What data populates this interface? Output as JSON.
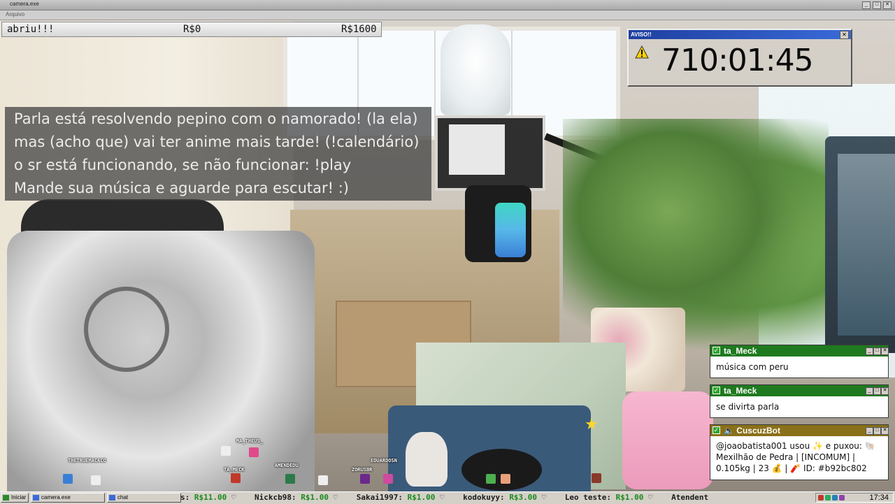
{
  "window": {
    "title": "camera.exe",
    "menu": "Arquivo"
  },
  "money_bar": {
    "label": "abriu!!!",
    "current": "R$0",
    "goal": "R$1600"
  },
  "aviso": {
    "title": "AVISO!!",
    "timer": "710:01:45",
    "close": "✕"
  },
  "notice": {
    "lines": [
      "Parla está resolvendo pepino com o namorado! (la ela)",
      "mas (acho que) vai ter anime mais tarde! (!calendário)",
      "o sr está funcionando, se não funcionar: !play",
      "Mande sua música e aguarde para escutar! :)"
    ]
  },
  "chat": [
    {
      "user": "ta_Meck",
      "message": "música com peru"
    },
    {
      "user": "ta_Meck",
      "message": "se divirta parla"
    },
    {
      "user": "CuscuzBot",
      "message": "@joaobatista001 usou ✨ e puxou: 🐚 Mexilhão de Pedra | [INCOMUM] | 0.105kg | 23 💰 | 🧨 ID: #b92bc802"
    }
  ],
  "avatars": [
    "THETRUEMACACO",
    "MA_THEUS_",
    "TA_MECK",
    "AMENDEDU",
    "ZORUSBR",
    "EDUARDOSN"
  ],
  "taskbar": {
    "start": "Iniciar",
    "app1": "camera.exe",
    "app2": "chat",
    "ticker": [
      {
        "name": "s:",
        "amount": "R$11.00"
      },
      {
        "name": "Nickcb98:",
        "amount": "R$1.00"
      },
      {
        "name": "Sakai1997:",
        "amount": "R$1.00"
      },
      {
        "name": "kodokuyy:",
        "amount": "R$3.00"
      },
      {
        "name": "Leo teste:",
        "amount": "R$1.00"
      },
      {
        "name": "Atendent",
        "amount": ""
      }
    ],
    "clock": "17:34"
  },
  "colors": {
    "chat_header_user": "#1f7a1f",
    "chat_header_bot": "#8a7018",
    "aviso_title": "#1e3fa0",
    "ticker_amount": "#1a8a1a"
  }
}
